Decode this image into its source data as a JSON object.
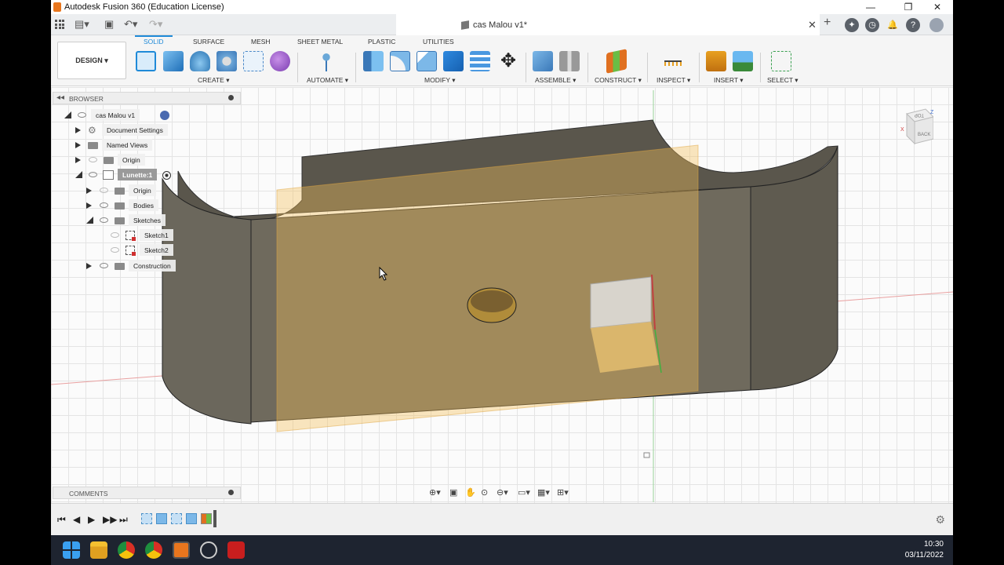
{
  "window": {
    "title": "Autodesk Fusion 360 (Education License)",
    "minimize": "—",
    "maximize": "❐",
    "close": "✕"
  },
  "tabs": {
    "document_title": "cas Malou v1*",
    "close": "✕",
    "add": "+"
  },
  "ribbon": {
    "workspace": "DESIGN ▾",
    "tabs": [
      "SOLID",
      "SURFACE",
      "MESH",
      "SHEET METAL",
      "PLASTIC",
      "UTILITIES"
    ],
    "active_tab": "SOLID",
    "groups": [
      "CREATE ▾",
      "AUTOMATE ▾",
      "MODIFY ▾",
      "ASSEMBLE ▾",
      "CONSTRUCT ▾",
      "INSPECT ▾",
      "INSERT ▾",
      "SELECT ▾"
    ]
  },
  "browser": {
    "title": "BROWSER",
    "collapse": "◂◂",
    "items": [
      {
        "label": "cas Malou v1"
      },
      {
        "label": "Document Settings"
      },
      {
        "label": "Named Views"
      },
      {
        "label": "Origin"
      },
      {
        "label": "Lunette:1"
      },
      {
        "label": "Origin"
      },
      {
        "label": "Bodies"
      },
      {
        "label": "Sketches"
      },
      {
        "label": "Sketch1"
      },
      {
        "label": "Sketch2"
      },
      {
        "label": "Construction"
      }
    ]
  },
  "comments": {
    "title": "COMMENTS"
  },
  "viewcube": {
    "top": "TOP",
    "back": "BACK",
    "axis_x": "X",
    "axis_z": "Z"
  },
  "taskbar": {
    "time": "10:30",
    "date": "03/11/2022"
  },
  "colors": {
    "accent": "#1f8ad8",
    "body": "#6f6a5d",
    "sketch_plane": "#f5c15a"
  }
}
